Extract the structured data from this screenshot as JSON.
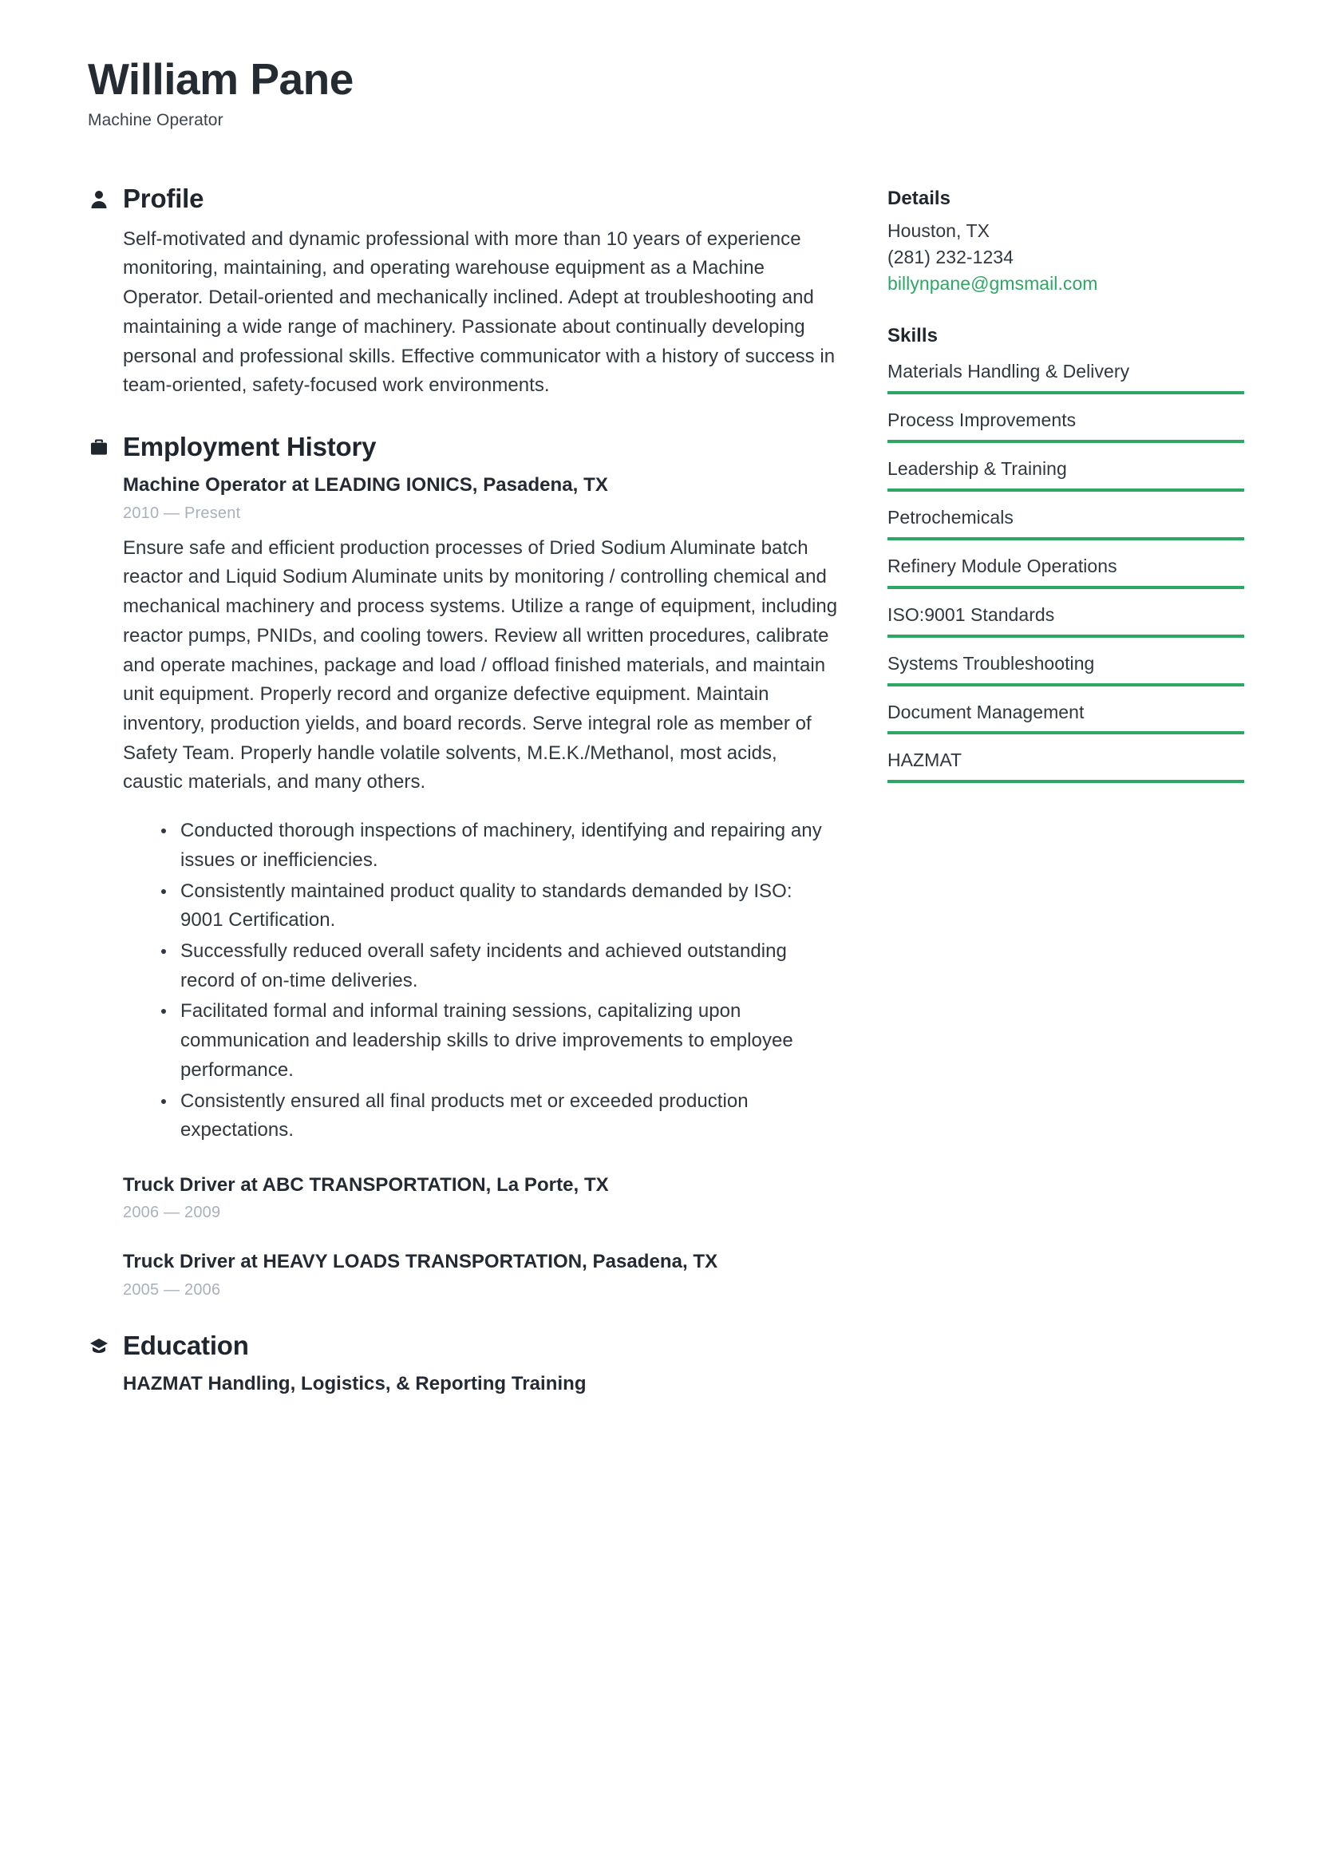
{
  "header": {
    "name": "William Pane",
    "title": "Machine Operator"
  },
  "sections": {
    "profile": {
      "heading": "Profile",
      "icon": "person-icon",
      "text": "Self-motivated and dynamic professional with more than 10 years of experience monitoring, maintaining, and operating warehouse equipment as a Machine Operator. Detail-oriented and mechanically inclined. Adept at troubleshooting and maintaining a wide range of machinery. Passionate about continually developing personal and professional skills. Effective communicator with a history of success in team-oriented, safety-focused work environments."
    },
    "employment": {
      "heading": "Employment History",
      "icon": "briefcase-icon",
      "jobs": [
        {
          "header": "Machine Operator  at LEADING IONICS, Pasadena, TX",
          "dates": "2010 — Present",
          "description": "Ensure safe and efficient production processes of Dried Sodium Aluminate batch reactor and Liquid Sodium Aluminate units by monitoring / controlling chemical and mechanical machinery and process systems. Utilize a range of equipment, including reactor pumps, PNIDs, and cooling towers. Review all written procedures, calibrate and operate machines, package and load / offload finished materials, and maintain unit equipment. Properly record and organize defective equipment. Maintain inventory, production yields, and board records. Serve integral role as member of Safety Team. Properly handle volatile solvents, M.E.K./Methanol, most acids, caustic materials, and many others.",
          "bullets": [
            "Conducted thorough inspections of machinery, identifying and repairing any issues or inefficiencies.",
            "Consistently maintained product quality to standards demanded by ISO: 9001 Certification.",
            "Successfully reduced overall safety incidents and achieved outstanding record of on-time deliveries.",
            "Facilitated formal and informal training sessions, capitalizing upon communication and leadership skills to drive improvements to employee performance.",
            "Consistently ensured all final products met or exceeded production expectations."
          ]
        },
        {
          "header": "Truck Driver at ABC TRANSPORTATION, La Porte, TX",
          "dates": "2006 — 2009",
          "description": "",
          "bullets": []
        },
        {
          "header": "Truck Driver at HEAVY LOADS TRANSPORTATION, Pasadena, TX",
          "dates": "2005 — 2006",
          "description": "",
          "bullets": []
        }
      ]
    },
    "education": {
      "heading": "Education",
      "icon": "graduation-cap-icon",
      "entries": [
        "HAZMAT Handling, Logistics, & Reporting Training"
      ]
    }
  },
  "sidebar": {
    "details": {
      "heading": "Details",
      "location": "Houston, TX",
      "phone": "(281) 232-1234",
      "email": "billynpane@gmsmail.com"
    },
    "skills": {
      "heading": "Skills",
      "items": [
        "Materials Handling & Delivery",
        "Process Improvements",
        "Leadership & Training",
        "Petrochemicals",
        "Refinery Module Operations",
        "ISO:9001 Standards",
        "Systems Troubleshooting",
        "Document Management",
        "HAZMAT"
      ]
    }
  },
  "colors": {
    "accent_green": "#2ea765",
    "text_dark": "#2b313b",
    "text_muted": "#a9b1bd"
  }
}
